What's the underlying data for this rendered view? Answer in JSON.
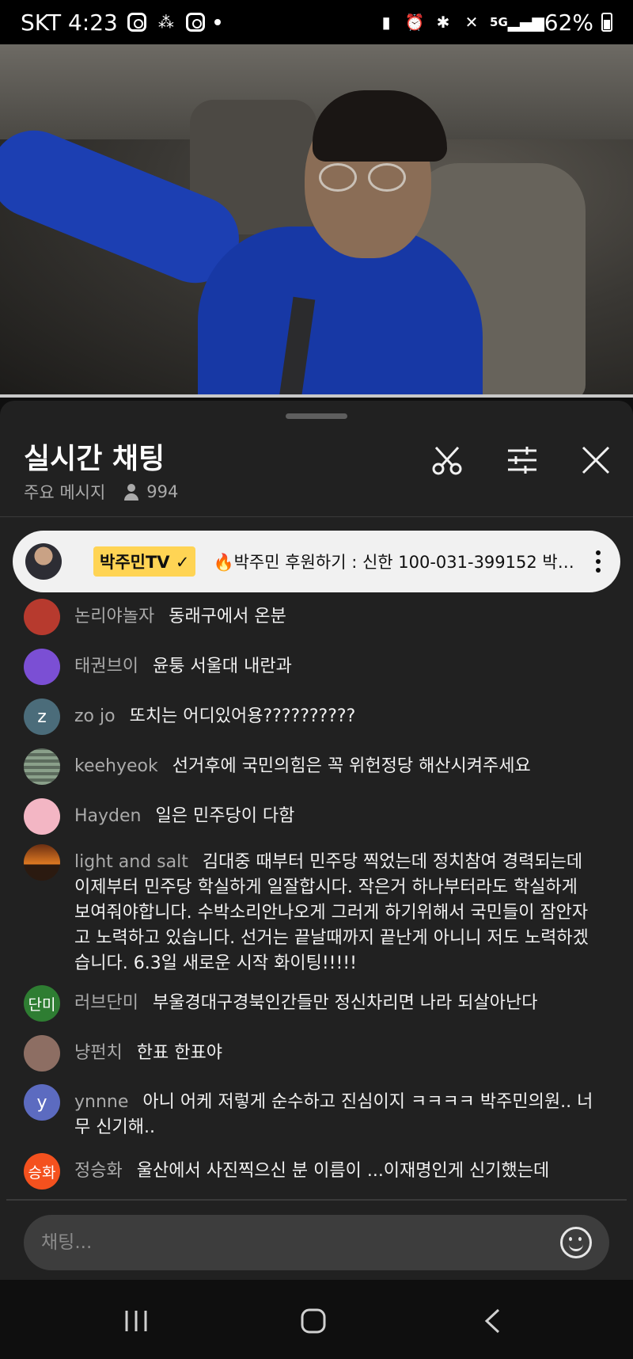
{
  "status_bar": {
    "carrier_time": "SKT 4:23",
    "battery": "62%",
    "network": "5G"
  },
  "chat": {
    "title": "실시간 채팅",
    "mode_label": "주요 메시지",
    "viewer_count": "994"
  },
  "pinned": {
    "badge": "박주민TV ✓",
    "message": "🔥박주민 후원하기 : 신한 100-031-399152 박…"
  },
  "messages": [
    {
      "author": "논리야놀자",
      "text": "동래구에서 온분",
      "avatar_initial": "",
      "avatar_color": "#b73a2e"
    },
    {
      "author": "태권브이",
      "text": "윤퉁 서울대 내란과",
      "avatar_initial": "",
      "avatar_color": "#7b4fd4"
    },
    {
      "author": "zo jo",
      "text": "또치는 어디있어용??????????",
      "avatar_initial": "z",
      "avatar_color": "#4b6c7a"
    },
    {
      "author": "keehyeok",
      "text": "선거후에 국민의힘은 꼭 위헌정당 해산시켜주세요",
      "avatar_initial": "",
      "avatar_color": "#6b7a6a"
    },
    {
      "author": "Hayden",
      "text": "일은 민주당이 다함",
      "avatar_initial": "",
      "avatar_color": "#f3b6c4"
    },
    {
      "author": "light and salt",
      "text": "김대중 때부터 민주당 찍었는데 정치참여 경력되는데 이제부터 민주당 학실하게 일잘합시다. 작은거 하나부터라도 학실하게 보여줘야합니다. 수박소리안나오게 그러게 하기위해서 국민들이 잠안자고 노력하고 있습니다. 선거는 끝날때까지 끝난게 아니니 저도 노력하겠습니다. 6.3일 새로운 시작 화이팅!!!!!",
      "avatar_initial": "",
      "avatar_color": "#c2531f"
    },
    {
      "author": "러브단미",
      "text": "부울경대구경북인간들만 정신차리면 나라 되살아난다",
      "avatar_initial": "단미",
      "avatar_color": "#2e7d32"
    },
    {
      "author": "냥펀치",
      "text": "한표 한표야",
      "avatar_initial": "",
      "avatar_color": "#8d6e63"
    },
    {
      "author": "ynnne",
      "text": "아니 어케 저렇게 순수하고 진심이지 ㅋㅋㅋㅋ 박주민의원.. 너무 신기해..",
      "avatar_initial": "y",
      "avatar_color": "#5c6bc0"
    },
    {
      "author": "정승화",
      "text": "울산에서 사진찍으신 분 이름이 ...이재명인게 신기했는데",
      "avatar_initial": "승화",
      "avatar_color": "#f4511e"
    }
  ],
  "input": {
    "placeholder": "채팅..."
  },
  "icons": {
    "clip": "scissors-icon",
    "filter": "sliders-icon",
    "close": "close-icon",
    "emoji": "emoji-icon"
  }
}
